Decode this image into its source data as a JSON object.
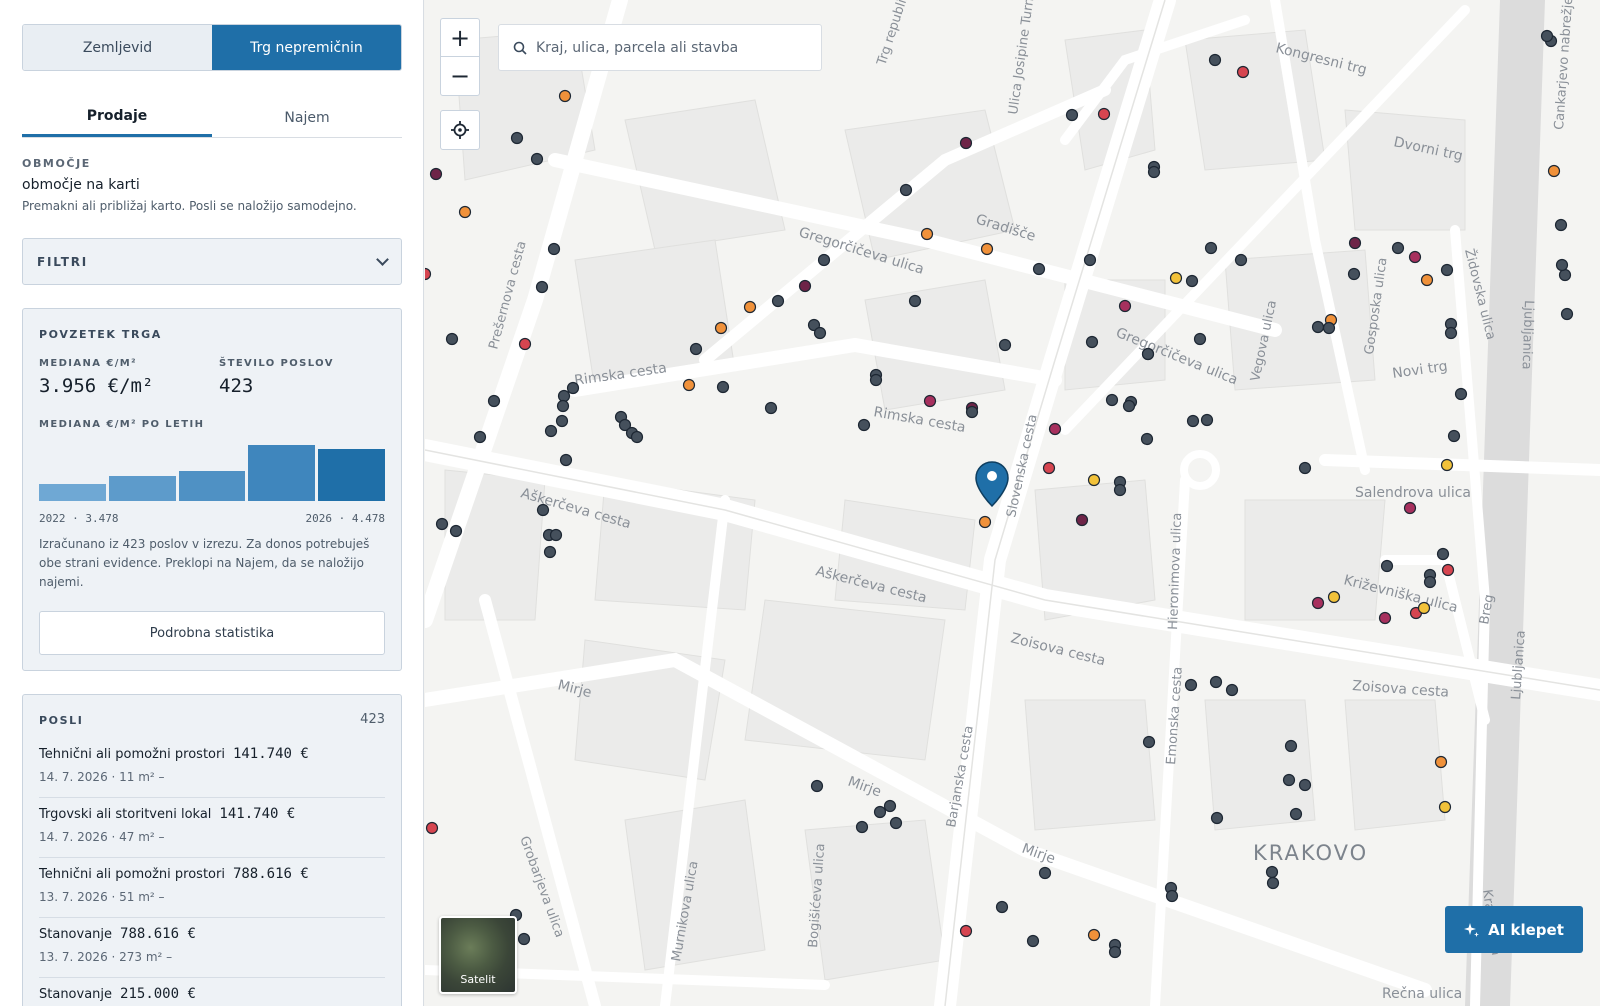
{
  "mode_switch": {
    "cadastre": "Zemljevid",
    "market": "Trg nepremičnin"
  },
  "deal_tabs": {
    "sales": "Prodaje",
    "rent": "Najem"
  },
  "area": {
    "label": "OBMOČJE",
    "value": "območje na karti",
    "hint": "Premakni ali približaj karto. Posli se naložijo samodejno."
  },
  "filters": {
    "label": "FILTRI"
  },
  "summary": {
    "title": "POVZETEK TRGA",
    "median_label": "MEDIANA €/M²",
    "median_value": "3.956 €/m²",
    "count_label": "ŠTEVILO POSLOV",
    "count_value": "423",
    "yearly_label": "MEDIANA €/M² PO LETIH",
    "yearly_start": "2022 · 3.478",
    "yearly_end": "2026 · 4.478",
    "note": "Izračunano iz 423 poslov v izrezu. Za donos potrebuješ obe strani evidence. Preklopi na Najem, da se naložijo najemi.",
    "detail_button": "Podrobna statistika"
  },
  "chart_data": {
    "type": "bar",
    "categories": [
      "2022",
      "2023",
      "2024",
      "2025",
      "2026"
    ],
    "values": [
      3478,
      3720,
      3850,
      4600,
      4478
    ],
    "ylim": [
      3000,
      4700
    ]
  },
  "deals": {
    "title": "POSLI",
    "count": "423",
    "items": [
      {
        "type": "Tehnični ali pomožni prostori",
        "price": "141.740 €",
        "meta": "14. 7. 2026 · 11 m²   –"
      },
      {
        "type": "Trgovski ali storitveni lokal",
        "price": "141.740 €",
        "meta": "14. 7. 2026 · 47 m²   –"
      },
      {
        "type": "Tehnični ali pomožni prostori",
        "price": "788.616 €",
        "meta": "13. 7. 2026 · 51 m²   –"
      },
      {
        "type": "Stanovanje",
        "price": "788.616 €",
        "meta": "13. 7. 2026 · 273 m²   –"
      },
      {
        "type": "Stanovanje",
        "price": "215.000 €",
        "meta": ""
      }
    ]
  },
  "map": {
    "zoom_in": "+",
    "zoom_out": "−",
    "search_placeholder": "Kraj, ulica, parcela ali stavba",
    "satellite_label": "Satelit",
    "ai_button": "AI klepet",
    "street_labels": [
      "Kongresni trg",
      "Dvorni trg",
      "Gradišče",
      "Gregorčičeva ulica",
      "Rimska cesta",
      "Aškerčeva cesta",
      "Zoisova cesta",
      "Mirje",
      "Novi trg",
      "Salendrova ulica",
      "Križevniška ulica",
      "KRAKOVO",
      "Slovenska cesta",
      "Prešernova cesta",
      "Barjanska cesta",
      "Emonska cesta",
      "Hieronimova ulica",
      "Gosposka ulica",
      "Vegova ulica",
      "Židovska ulica",
      "Ljubljanica",
      "Cankarjevo nabrežje",
      "Ulica Josipine Turnograjske",
      "Trg republike",
      "Grobarjeva ulica",
      "Murnikova ulica",
      "Bogišićeva ulica",
      "Rečna ulica",
      "Breg",
      "Krakovska"
    ],
    "marker_colors": {
      "dark": "#45505c",
      "orange": "#f0913a",
      "red": "#d64550",
      "plum": "#6e2448",
      "magenta": "#a7305e",
      "yellow": "#f2c23a",
      "pin": "#1f6fa8"
    }
  }
}
